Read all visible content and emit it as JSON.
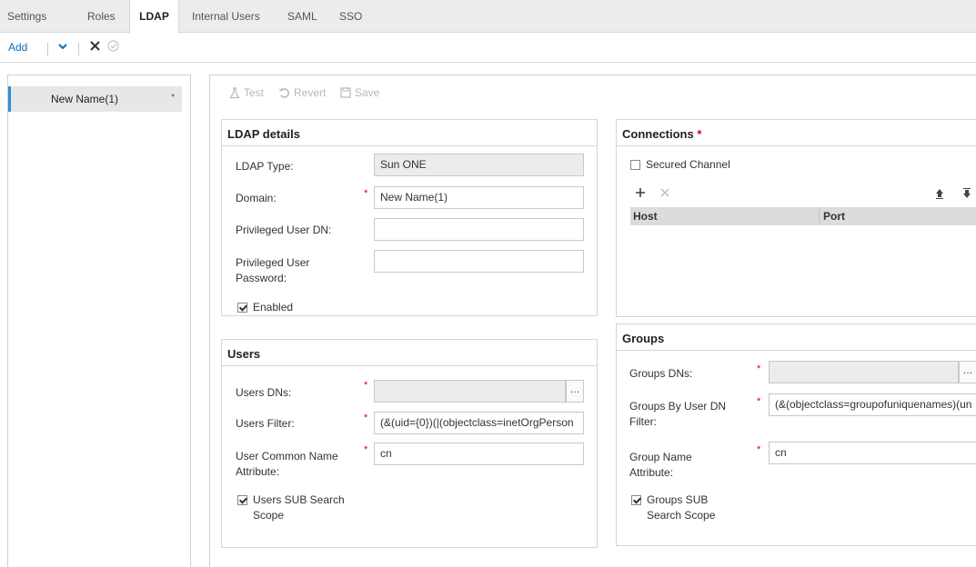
{
  "tabs": [
    "Settings",
    "Roles",
    "LDAP",
    "Internal Users",
    "SAML",
    "SSO"
  ],
  "toolbar": {
    "add_label": "Add"
  },
  "sidebar": {
    "items": [
      {
        "label": "New Name(1)",
        "marker": "*"
      }
    ]
  },
  "actions": {
    "test": "Test",
    "revert": "Revert",
    "save": "Save"
  },
  "ldap_details": {
    "title": "LDAP details",
    "ldap_type_label": "LDAP Type:",
    "ldap_type_value": "Sun ONE",
    "domain_label": "Domain:",
    "domain_value": "New Name(1)",
    "priv_dn_label": "Privileged User DN:",
    "priv_dn_value": "",
    "priv_pw_label_1": "Privileged User",
    "priv_pw_label_2": "Password:",
    "priv_pw_value": "",
    "enabled_label": "Enabled",
    "enabled": true
  },
  "connections": {
    "title": "Connections",
    "required_mark": "*",
    "secured_label": "Secured Channel",
    "secured": false,
    "columns": [
      "Host",
      "Port"
    ],
    "rows": []
  },
  "users": {
    "title": "Users",
    "dns_label": "Users DNs:",
    "dns_value": "",
    "filter_label": "Users Filter:",
    "filter_value": "(&(uid={0})(|(objectclass=inetOrgPerson",
    "cn_label_1": "User Common Name",
    "cn_label_2": "Attribute:",
    "cn_value": "cn",
    "sub_label_1": "Users SUB Search",
    "sub_label_2": "Scope",
    "sub_checked": true
  },
  "groups": {
    "title": "Groups",
    "dns_label": "Groups DNs:",
    "dns_value": "",
    "by_user_label_1": "Groups By User DN",
    "by_user_label_2": "Filter:",
    "by_user_value": "(&(objectclass=groupofuniquenames)(un",
    "name_label_1": "Group Name",
    "name_label_2": "Attribute:",
    "name_value": "cn",
    "sub_label_1": "Groups SUB",
    "sub_label_2": "Search Scope",
    "sub_checked": true
  },
  "colors": {
    "accent": "#2c8ed8",
    "required": "#d0021b",
    "link": "#0a6fb5"
  }
}
